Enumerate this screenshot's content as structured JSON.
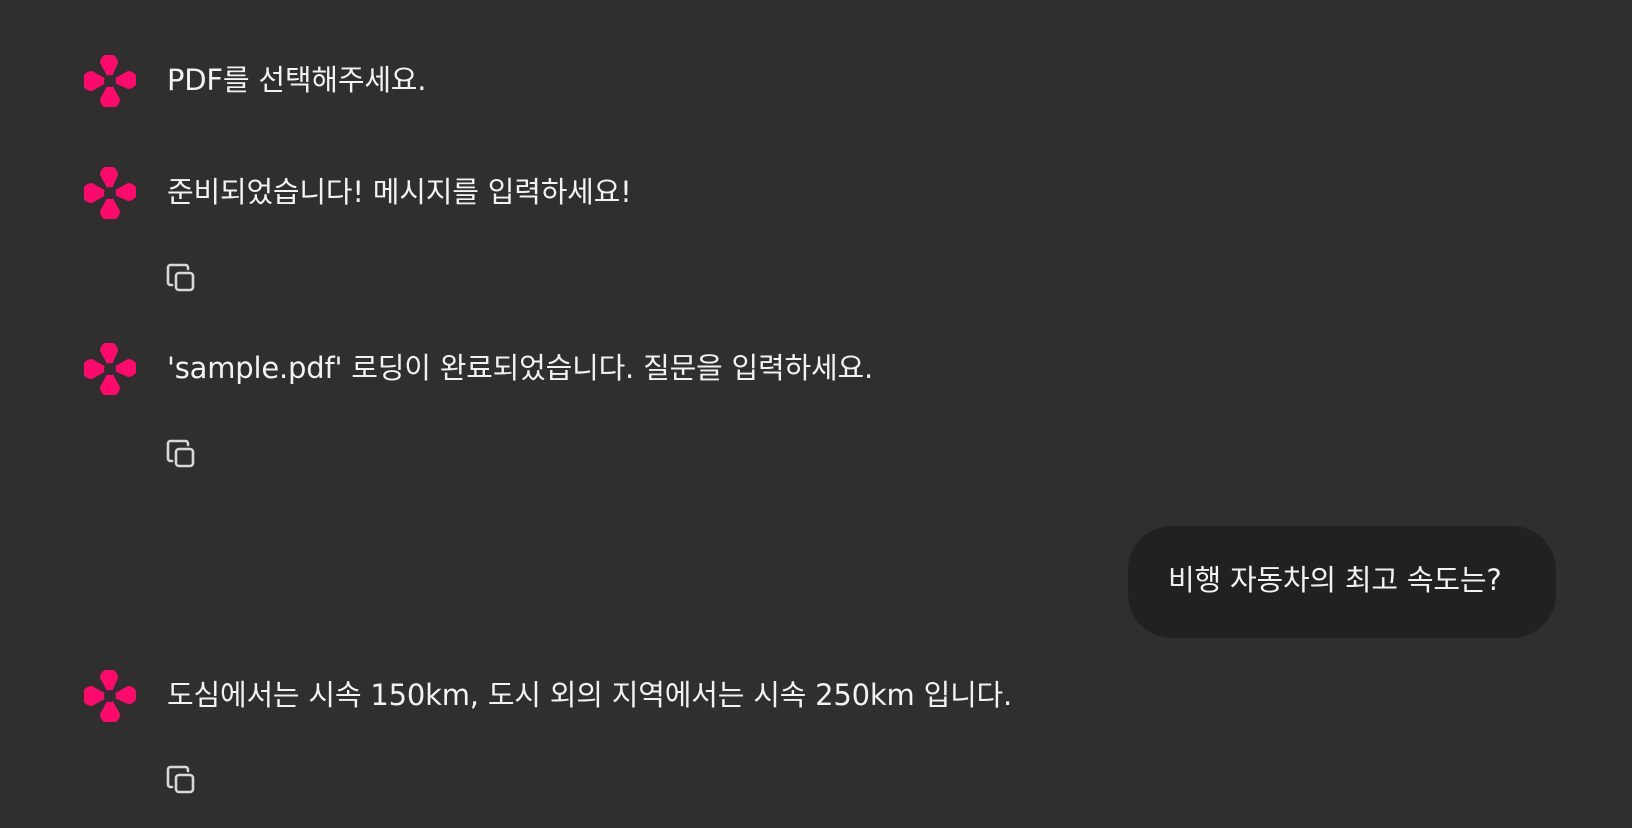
{
  "colors": {
    "background": "#2f2f2f",
    "user_bubble": "#212121",
    "accent": "#ff0a6c",
    "text": "#f2f2f2",
    "icon": "#d8d8d8"
  },
  "icons": {
    "assistant_avatar": "pink-four-petal-logo-icon",
    "copy": "copy-icon"
  },
  "messages": [
    {
      "role": "assistant",
      "text": "PDF를 선택해주세요.",
      "has_copy": false
    },
    {
      "role": "assistant",
      "text": "준비되었습니다! 메시지를 입력하세요!",
      "has_copy": true
    },
    {
      "role": "assistant",
      "text": "'sample.pdf' 로딩이 완료되었습니다. 질문을 입력하세요.",
      "has_copy": true
    },
    {
      "role": "user",
      "text": "비행 자동차의 최고 속도는?"
    },
    {
      "role": "assistant",
      "text": "도심에서는 시속 150km, 도시 외의 지역에서는 시속 250km 입니다.",
      "has_copy": true
    }
  ]
}
